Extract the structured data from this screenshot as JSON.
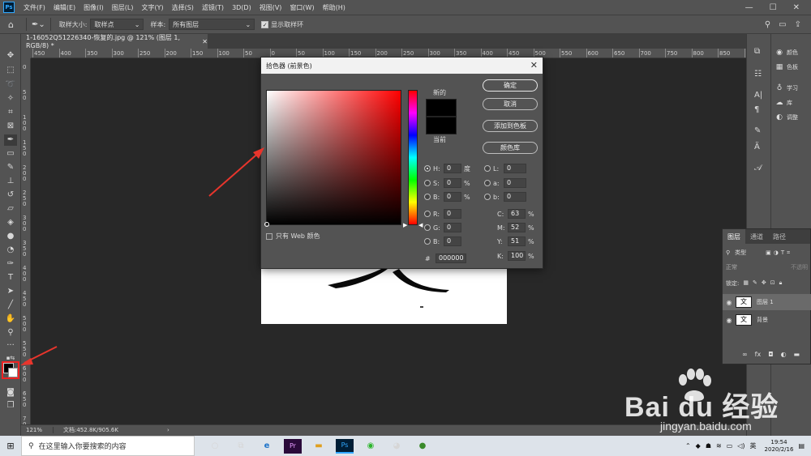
{
  "app": {
    "logo": "Ps"
  },
  "menubar": {
    "items": [
      "文件(F)",
      "编辑(E)",
      "图像(I)",
      "图层(L)",
      "文字(Y)",
      "选择(S)",
      "滤镜(T)",
      "3D(D)",
      "视图(V)",
      "窗口(W)",
      "帮助(H)"
    ]
  },
  "options": {
    "sample_size_label": "取样大小:",
    "sample_size_value": "取样点",
    "sample_label": "样本:",
    "sample_value": "所有图层",
    "show_ring_label": "显示取样环",
    "show_ring_checked": true
  },
  "document": {
    "tab_title": "1-16052Q51226340-恢复的.jpg @ 121% (图层 1, RGB/8) *",
    "zoom": "121%",
    "doc_info": "文档:452.8K/905.6K"
  },
  "ruler_h_ticks": [
    "450",
    "400",
    "350",
    "300",
    "250",
    "200",
    "150",
    "100",
    "50",
    "0",
    "50",
    "100",
    "150",
    "200",
    "250",
    "300",
    "350",
    "400",
    "450",
    "500",
    "550",
    "600",
    "650",
    "700",
    "750",
    "800",
    "850",
    "900"
  ],
  "color_picker": {
    "title": "拾色器 (前景色)",
    "new_label": "新的",
    "current_label": "当前",
    "new_color": "#000000",
    "current_color": "#000000",
    "buttons": {
      "ok": "确定",
      "cancel": "取消",
      "add_swatch": "添加到色板",
      "libraries": "颜色库"
    },
    "web_only": "只有 Web 颜色",
    "fields": {
      "H": "0",
      "H_unit": "度",
      "S": "0",
      "S_unit": "%",
      "B": "0",
      "B_unit": "%",
      "R": "0",
      "G": "0",
      "Bv": "0",
      "L": "0",
      "a": "0",
      "b": "0",
      "C": "63",
      "M": "52",
      "Y": "51",
      "K": "100",
      "hex": "000000"
    },
    "labels": {
      "H": "H:",
      "S": "S:",
      "B": "B:",
      "R": "R:",
      "G": "G:",
      "Bv": "B:",
      "L": "L:",
      "a": "a:",
      "b": "b:",
      "C": "C:",
      "M": "M:",
      "Y": "Y:",
      "K": "K:",
      "hash": "#",
      "pct": "%"
    }
  },
  "right_panels": {
    "items": [
      "颜色",
      "色板",
      "学习",
      "库",
      "调整"
    ]
  },
  "layers": {
    "tabs": [
      "图层",
      "通道",
      "路径"
    ],
    "filter_placeholder": "类型",
    "blend_mode": "正常",
    "opacity_label": "不透明",
    "lock_label": "锁定:",
    "items": [
      {
        "name": "图层 1",
        "thumb": "文",
        "selected": true
      },
      {
        "name": "背景",
        "thumb": "文",
        "selected": false
      }
    ]
  },
  "watermark": {
    "brand": "Bai du 经验",
    "url": "jingyan.baidu.com"
  },
  "taskbar": {
    "search_placeholder": "在这里输入你要搜索的内容",
    "ime": "英",
    "time": "19:54",
    "date": "2020/2/16"
  }
}
